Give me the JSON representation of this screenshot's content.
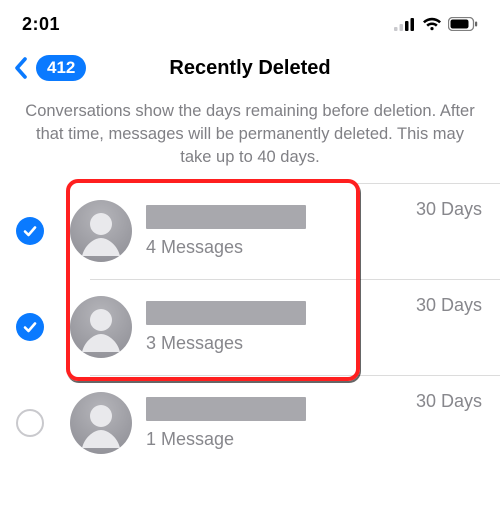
{
  "status": {
    "time": "2:01"
  },
  "nav": {
    "back_count": "412",
    "title": "Recently Deleted"
  },
  "info": "Conversations show the days remaining before deletion. After that time, messages will be permanently deleted. This may take up to 40 days.",
  "rows": [
    {
      "selected": true,
      "subtitle": "4 Messages",
      "days": "30 Days"
    },
    {
      "selected": true,
      "subtitle": "3 Messages",
      "days": "30 Days"
    },
    {
      "selected": false,
      "subtitle": "1 Message",
      "days": "30 Days"
    }
  ],
  "colors": {
    "accent": "#0a7aff",
    "muted": "#87878c",
    "redacted": "#a8a8ad",
    "highlight": "#ff1f1f"
  }
}
